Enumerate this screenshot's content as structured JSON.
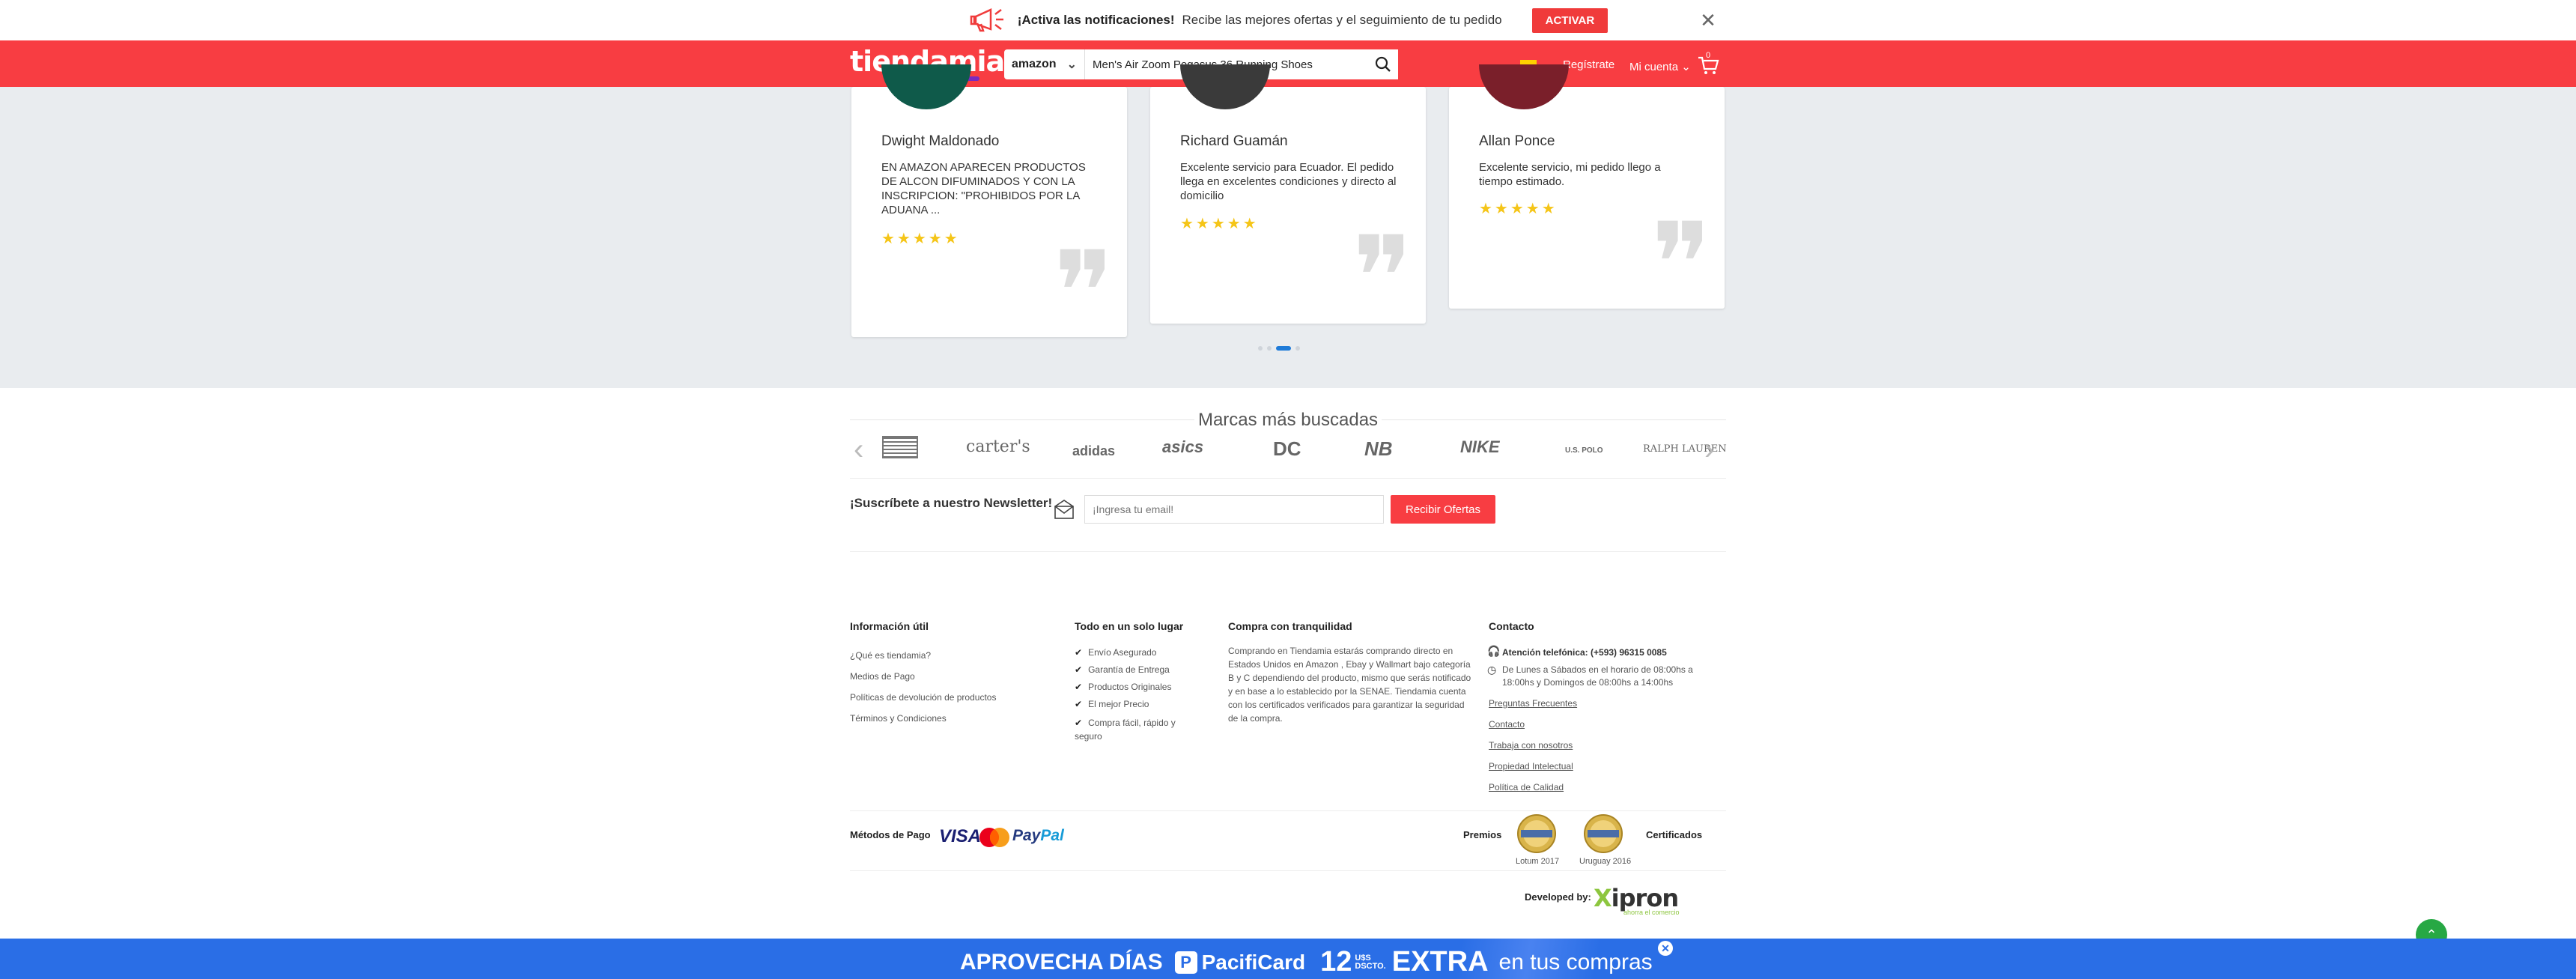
{
  "notification": {
    "title": "¡Activa las notificaciones!",
    "text": "Recibe las mejores ofertas y el seguimiento de tu pedido",
    "button": "ACTIVAR",
    "close": "✕"
  },
  "header": {
    "logo": "tiendamia",
    "store": "amazon",
    "search_value": "Men's Air Zoom Pegasus 36 Running Shoes",
    "register": "Regístrate",
    "account": "Mi cuenta",
    "cart_count": "0"
  },
  "reviews": [
    {
      "name": "Dwight Maldonado",
      "text": "EN AMAZON APARECEN PRODUCTOS DE ALCON DIFUMINADOS Y CON LA INSCRIPCION: \"PROHIBIDOS POR LA ADUANA ...",
      "stars": "★★★★★",
      "avatar_color": "#0f5a4a"
    },
    {
      "name": "Richard Guamán",
      "text": "Excelente servicio para Ecuador. El pedido llega en excelentes condiciones y directo al domicilio",
      "stars": "★★★★★",
      "avatar_color": "#3a3a3a"
    },
    {
      "name": "Allan Ponce",
      "text": "Excelente servicio, mi pedido llego a tiempo estimado.",
      "stars": "★★★★★",
      "avatar_color": "#7a1f2a"
    }
  ],
  "brands": {
    "title": "Marcas más buscadas",
    "items": [
      "carter's",
      "adidas",
      "asics",
      "DC",
      "NB",
      "NIKE",
      "U.S. POLO",
      "RALPH LAUREN"
    ]
  },
  "newsletter": {
    "label": "¡Suscríbete a nuestro Newsletter!",
    "placeholder": "¡Ingresa tu email!",
    "button": "Recibir Ofertas"
  },
  "footer": {
    "info": {
      "title": "Información útil",
      "links": [
        "¿Qué es tiendamia?",
        "Medios de Pago",
        "Políticas de devolución de productos",
        "Términos y Condiciones"
      ]
    },
    "todo": {
      "title": "Todo en un solo lugar",
      "items": [
        "Envío Asegurado",
        "Garantía de Entrega",
        "Productos Originales",
        "El mejor Precio",
        "Compra fácil, rápido y seguro"
      ]
    },
    "compra": {
      "title": "Compra con tranquilidad",
      "text": "Comprando en Tiendamia estarás comprando directo en Estados Unidos en Amazon , Ebay y Wallmart bajo categoría B y C dependiendo del producto, mismo que serás notificado y en base a lo establecido por la SENAE. Tiendamia cuenta con los certificados verificados para garantizar la seguridad de la compra."
    },
    "contacto": {
      "title": "Contacto",
      "phone": "Atención telefónica: (+593) 96315 0085",
      "hours": "De Lunes a Sábados en el horario de 08:00hs a 18:00hs y Domingos de 08:00hs a 14:00hs",
      "links": [
        "Preguntas Frecuentes",
        "Contacto",
        "Trabaja con nosotros",
        "Propiedad Intelectual",
        "Política de Calidad"
      ]
    },
    "payment_label": "Métodos de Pago",
    "visa": "VISA",
    "paypal_a": "Pay",
    "paypal_b": "Pal",
    "premios": "Premios",
    "medal1": "Lotum 2017",
    "medal2": "Uruguay 2016",
    "certificados": "Certificados",
    "developed_by": "Developed by:",
    "xipron_x": "X",
    "xipron_rest": "ipron",
    "xipron_sub": "ahorra el comercio"
  },
  "promo": {
    "t1": "APROVECHA DÍAS",
    "card": "PacifiCard",
    "num": "12",
    "usd": "U$S",
    "dscto": "DSCTO.",
    "extra": "EXTRA",
    "tail": "en tus compras",
    "close": "✕"
  },
  "colors": {
    "brand_red": "#f83d42",
    "promo_blue": "#2a6ee6",
    "star": "#f5c518"
  }
}
